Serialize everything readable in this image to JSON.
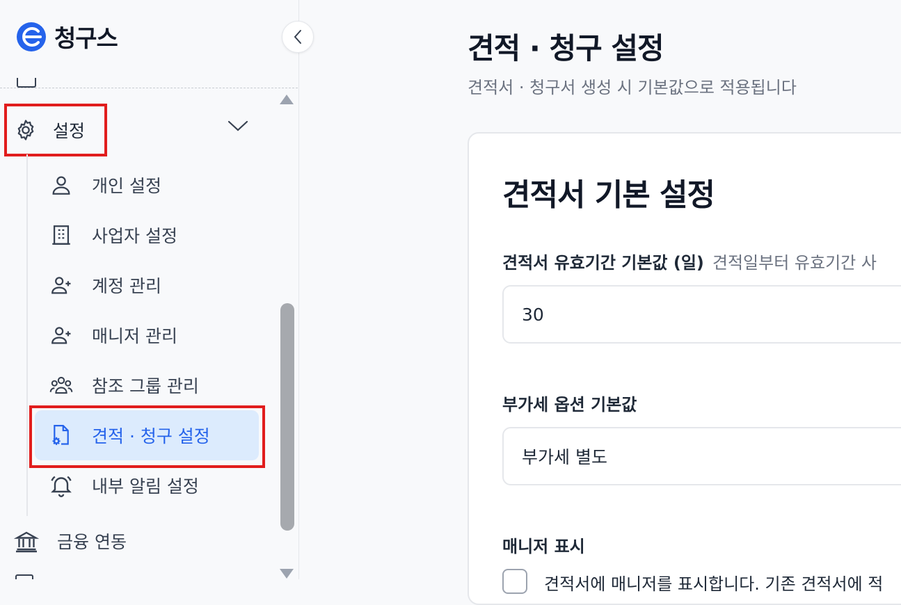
{
  "app": {
    "name": "청구스"
  },
  "sidebar": {
    "parent_item": {
      "label": "설정"
    },
    "sub_items": [
      {
        "label": "개인 설정",
        "icon": "user-icon"
      },
      {
        "label": "사업자 설정",
        "icon": "building-icon"
      },
      {
        "label": "계정 관리",
        "icon": "user-plus-icon"
      },
      {
        "label": "매니저 관리",
        "icon": "user-plus-icon"
      },
      {
        "label": "참조 그룹 관리",
        "icon": "users-group-icon"
      },
      {
        "label": "견적 · 청구 설정",
        "icon": "file-settings-icon",
        "active": true
      },
      {
        "label": "내부 알림 설정",
        "icon": "bell-icon"
      }
    ],
    "bottom_item": {
      "label": "금융 연동",
      "icon": "bank-icon"
    }
  },
  "main": {
    "title": "견적 · 청구 설정",
    "subtitle": "견적서 · 청구서 생성 시 기본값으로 적용됩니다",
    "card": {
      "title": "견적서 기본 설정",
      "validity": {
        "label": "견적서 유효기간 기본값 (일)",
        "hint": "견적일부터 유효기간 사",
        "value": "30"
      },
      "vat": {
        "label": "부가세 옵션 기본값",
        "value": "부가세 별도"
      },
      "manager": {
        "label": "매니저 표시",
        "checkbox_label": "견적서에 매니저를 표시합니다. 기존 견적서에 적"
      }
    }
  },
  "colors": {
    "accent": "#2563eb",
    "active_bg": "#dcebfd",
    "highlight": "#e11d1d",
    "logo": "#2563eb"
  }
}
